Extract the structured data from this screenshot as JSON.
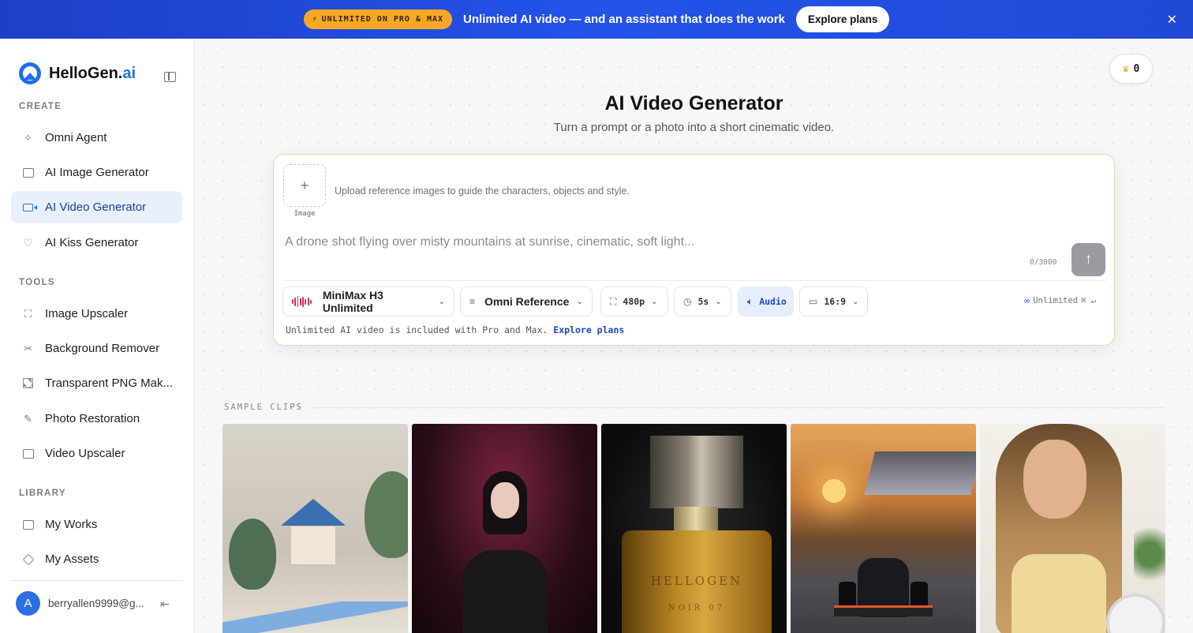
{
  "banner": {
    "pill": "UNLIMITED ON PRO & MAX",
    "pill_icon": "⚡",
    "text": "Unlimited AI video — and an assistant that does the work",
    "cta": "Explore plans",
    "close": "✕"
  },
  "brand": {
    "name": "HelloGen.",
    "suffix": "ai"
  },
  "sidebar": {
    "create_label": "CREATE",
    "create_items": [
      {
        "label": "Omni Agent",
        "icon": "sparkle-icon"
      },
      {
        "label": "AI Image Generator",
        "icon": "image-icon"
      },
      {
        "label": "AI Video Generator",
        "icon": "video-icon",
        "active": true
      },
      {
        "label": "AI Kiss Generator",
        "icon": "heart-icon"
      }
    ],
    "tools_label": "TOOLS",
    "tools_items": [
      {
        "label": "Image Upscaler",
        "icon": "expand-icon"
      },
      {
        "label": "Background Remover",
        "icon": "scissors-icon"
      },
      {
        "label": "Transparent PNG Mak...",
        "icon": "checker-icon"
      },
      {
        "label": "Photo Restoration",
        "icon": "pencil-icon"
      },
      {
        "label": "Video Upscaler",
        "icon": "video-upscale-icon"
      }
    ],
    "library_label": "LIBRARY",
    "library_items": [
      {
        "label": "My Works",
        "icon": "image-icon"
      },
      {
        "label": "My Assets",
        "icon": "cube-icon"
      }
    ],
    "user": {
      "initial": "A",
      "email": "berryallen9999@g..."
    }
  },
  "header": {
    "credits": "0"
  },
  "main": {
    "title": "AI Video Generator",
    "subtitle": "Turn a prompt or a photo into a short cinematic video."
  },
  "composer": {
    "upload_plus": "+",
    "upload_label": "Image",
    "upload_hint": "Upload reference images to guide the characters, objects and style.",
    "prompt_value": "",
    "prompt_placeholder": "A drone shot flying over misty mountains at sunrise, cinematic, soft light...",
    "char_count": "0/3000",
    "send_icon": "↑",
    "model": "MiniMax H3 Unlimited",
    "mode": "Omni Reference",
    "resolution": "480p",
    "duration": "5s",
    "audio": "Audio",
    "aspect": "16:9",
    "unlimited": "Unlimited",
    "shortcut": "⌘ ↵",
    "footnote": "Unlimited AI video is included with Pro and Max.",
    "footnote_link": "Explore plans"
  },
  "samples": {
    "label": "SAMPLE CLIPS",
    "bottle_brand": "HELLOGEN",
    "bottle_sub": "NOIR 07"
  },
  "colors": {
    "accent": "#1e6ff0",
    "banner": "#2353e8",
    "pill": "#f7a823"
  }
}
